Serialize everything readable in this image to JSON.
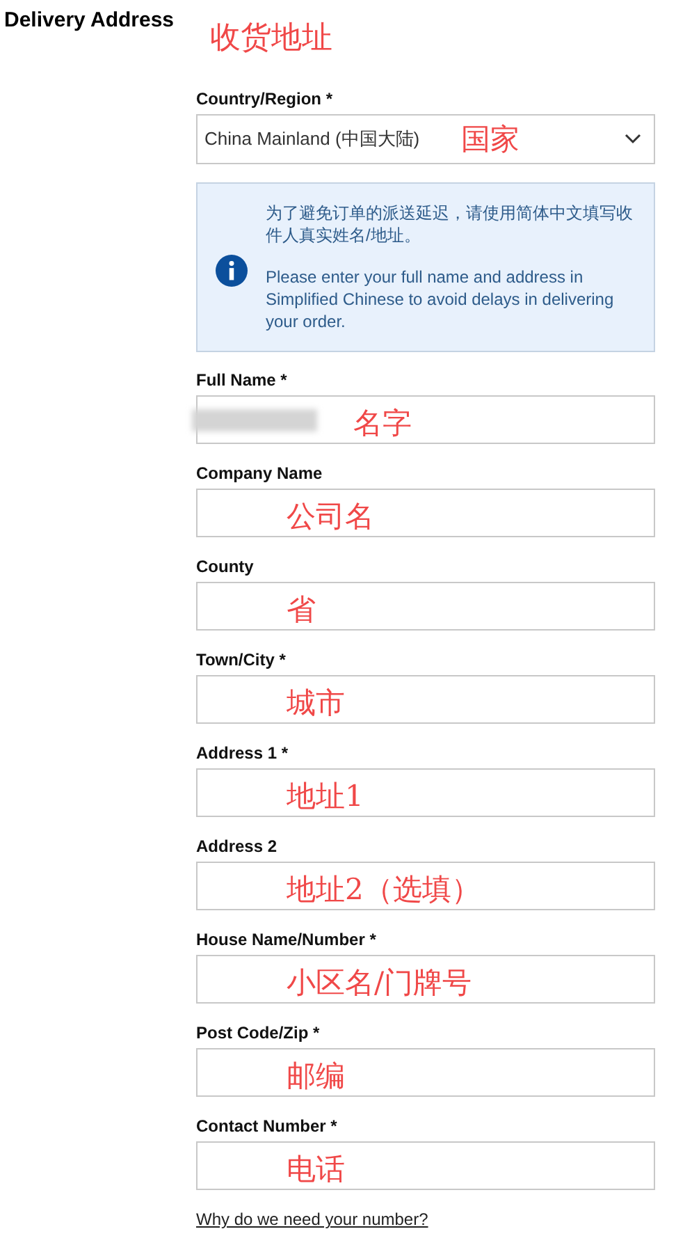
{
  "title": "Delivery Address",
  "title_annotation": "收货地址",
  "country": {
    "label": "Country/Region *",
    "value": "China Mainland (中国大陆)",
    "annotation": "国家"
  },
  "notice": {
    "chinese": "为了避免订单的派送延迟，请使用简体中文填写收件人真实姓名/地址。",
    "english": "Please enter your full name and address in Simplified Chinese to avoid delays in delivering your order."
  },
  "fields": [
    {
      "label": "Full Name *",
      "annotation": "名字",
      "redacted": true
    },
    {
      "label": "Company Name",
      "annotation": "公司名",
      "redacted": false
    },
    {
      "label": "County",
      "annotation": "省",
      "redacted": false
    },
    {
      "label": "Town/City *",
      "annotation": "城市",
      "redacted": false
    },
    {
      "label": "Address 1 *",
      "annotation": "地址1",
      "redacted": false
    },
    {
      "label": "Address 2",
      "annotation": "地址2（选填）",
      "redacted": false
    },
    {
      "label": "House Name/Number *",
      "annotation": "小区名/门牌号",
      "redacted": false
    },
    {
      "label": "Post Code/Zip *",
      "annotation": "邮编",
      "redacted": false
    },
    {
      "label": "Contact Number *",
      "annotation": "电话",
      "redacted": false
    }
  ],
  "help_link": "Why do we need your number?"
}
